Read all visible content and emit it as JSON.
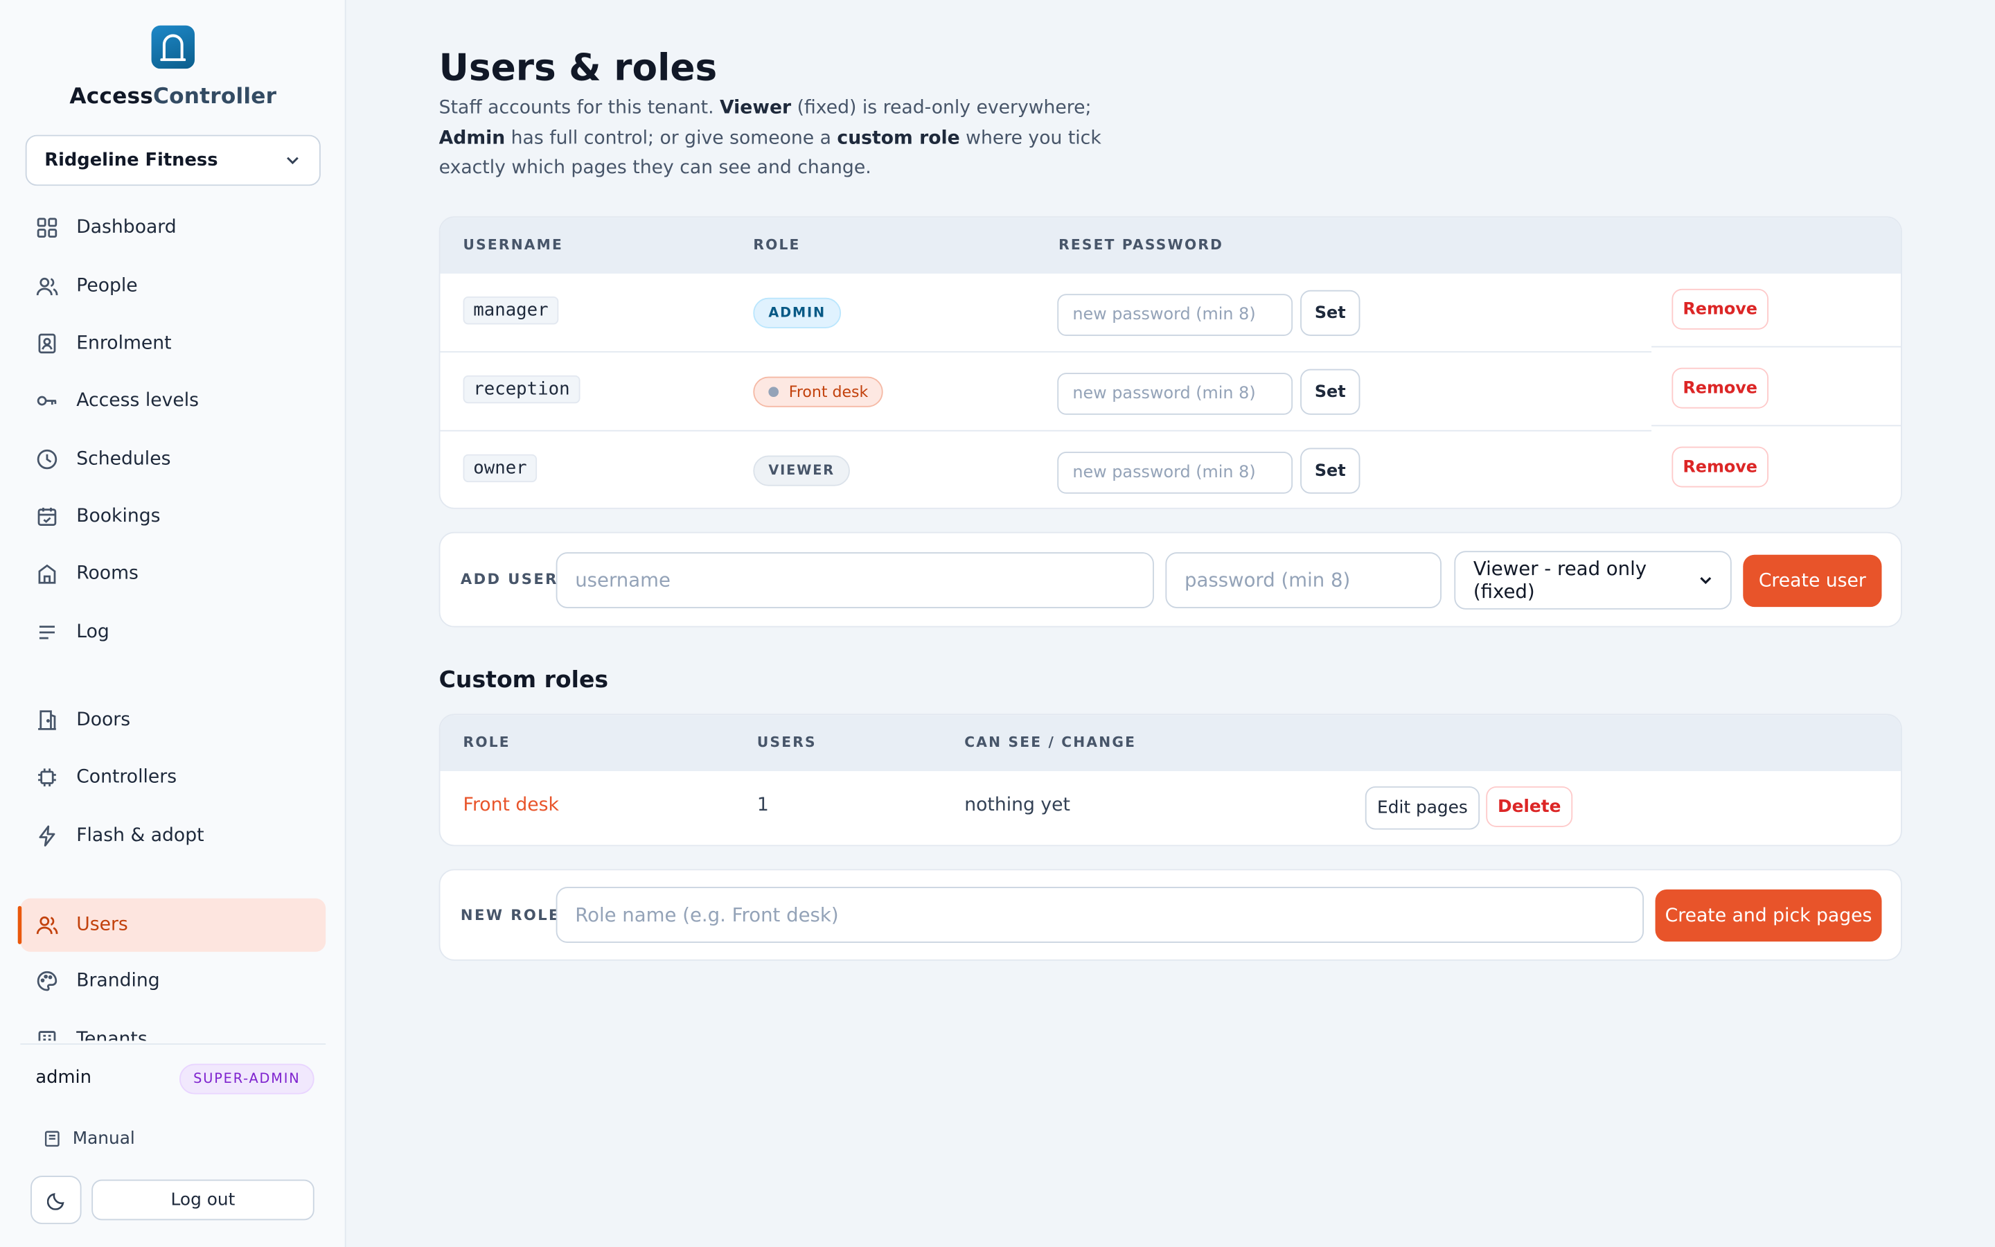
{
  "brand": {
    "part1": "Access",
    "part2": "Controller"
  },
  "tenant": {
    "selected": "Ridgeline Fitness"
  },
  "nav": [
    {
      "label": "Dashboard",
      "icon": "grid-icon"
    },
    {
      "label": "People",
      "icon": "people-icon"
    },
    {
      "label": "Enrolment",
      "icon": "badge-icon"
    },
    {
      "label": "Access levels",
      "icon": "key-icon"
    },
    {
      "label": "Schedules",
      "icon": "clock-icon"
    },
    {
      "label": "Bookings",
      "icon": "calendar-icon"
    },
    {
      "label": "Rooms",
      "icon": "room-icon"
    },
    {
      "label": "Log",
      "icon": "list-icon"
    },
    {
      "label": "Doors",
      "icon": "door-icon"
    },
    {
      "label": "Controllers",
      "icon": "chip-icon"
    },
    {
      "label": "Flash & adopt",
      "icon": "bolt-icon"
    },
    {
      "label": "Users",
      "icon": "users-icon",
      "active": true
    },
    {
      "label": "Branding",
      "icon": "palette-icon"
    },
    {
      "label": "Tenants",
      "icon": "building-icon"
    }
  ],
  "footer": {
    "username": "admin",
    "role_badge": "SUPER-ADMIN",
    "manual": "Manual",
    "logout": "Log out"
  },
  "page": {
    "title": "Users & roles",
    "desc_1": "Staff accounts for this tenant. ",
    "desc_viewer": "Viewer",
    "desc_2": " (fixed) is read-only everywhere; ",
    "desc_admin": "Admin",
    "desc_3": " has full control; or give someone a ",
    "desc_custom": "custom role",
    "desc_4": " where you tick exactly which pages they can see and change."
  },
  "users_table": {
    "headers": [
      "USERNAME",
      "ROLE",
      "RESET PASSWORD"
    ],
    "password_placeholder": "new password (min 8)",
    "set_label": "Set",
    "remove_label": "Remove",
    "rows": [
      {
        "username": "manager",
        "role": "ADMIN"
      },
      {
        "username": "reception",
        "role": "Front desk"
      },
      {
        "username": "owner",
        "role": "VIEWER"
      }
    ]
  },
  "add_user": {
    "label": "ADD USER",
    "username_placeholder": "username",
    "password_placeholder": "password (min 8)",
    "role_selected": "Viewer - read only (fixed)",
    "create_label": "Create user"
  },
  "custom_roles": {
    "title": "Custom roles",
    "headers": [
      "ROLE",
      "USERS",
      "CAN SEE / CHANGE"
    ],
    "rows": [
      {
        "role": "Front desk",
        "users": "1",
        "pages": "nothing yet",
        "edit": "Edit pages",
        "delete": "Delete"
      }
    ]
  },
  "new_role": {
    "label": "NEW ROLE",
    "placeholder": "Role name (e.g. Front desk)",
    "create_label": "Create and pick pages"
  },
  "colors": {
    "accent": "#e8542a",
    "danger": "#dc2626",
    "sidebar_active_bg": "#fde5df"
  }
}
